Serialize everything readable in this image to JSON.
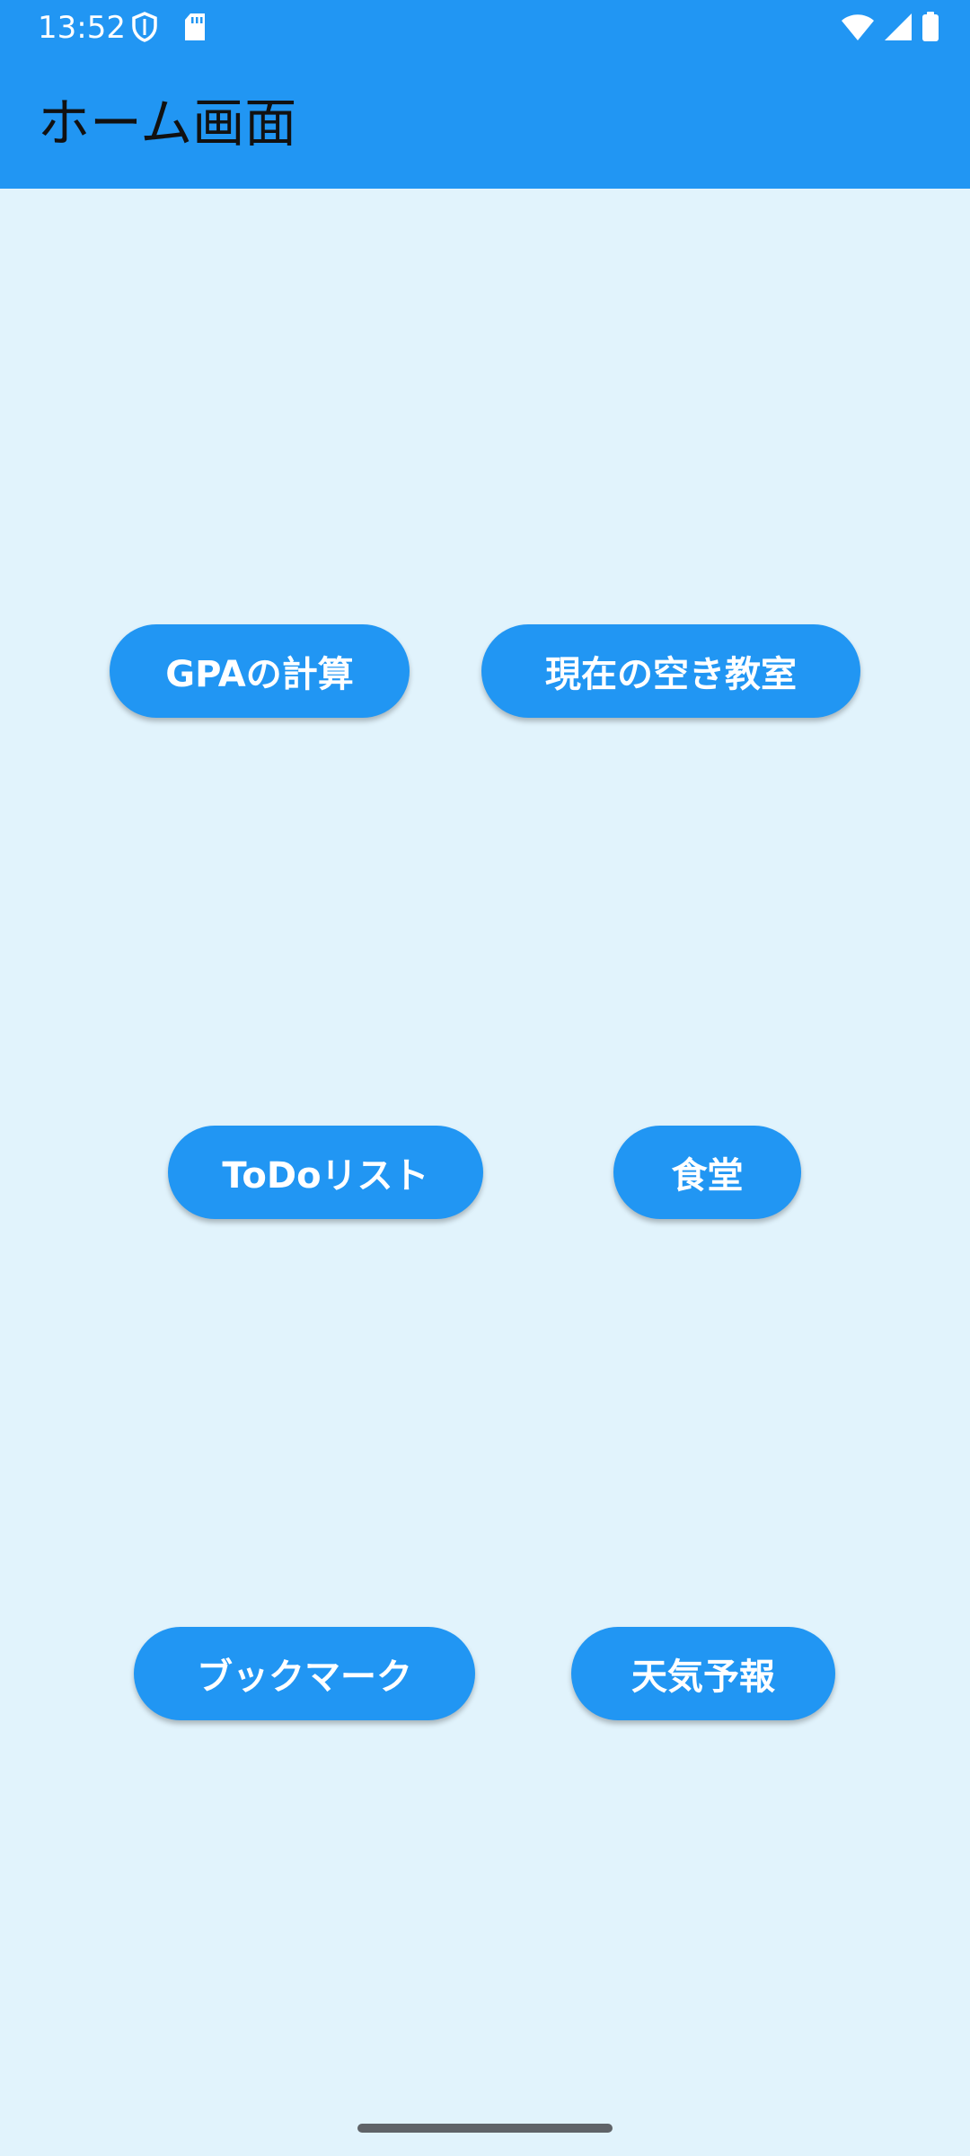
{
  "status_bar": {
    "time": "13:52",
    "left_icons": [
      "shield-icon",
      "sd-card-icon"
    ],
    "right_icons": [
      "wifi-icon",
      "signal-icon",
      "battery-icon"
    ]
  },
  "app_bar": {
    "title": "ホーム画面"
  },
  "buttons": {
    "gpa": "GPAの計算",
    "empty_classroom": "現在の空き教室",
    "todo": "ToDoリスト",
    "cafeteria": "食堂",
    "bookmark": "ブックマーク",
    "weather": "天気予報"
  },
  "colors": {
    "primary": "#2196F3",
    "background": "#E1F3FC",
    "button_text": "#FFFFFF",
    "title_text": "#111111"
  }
}
